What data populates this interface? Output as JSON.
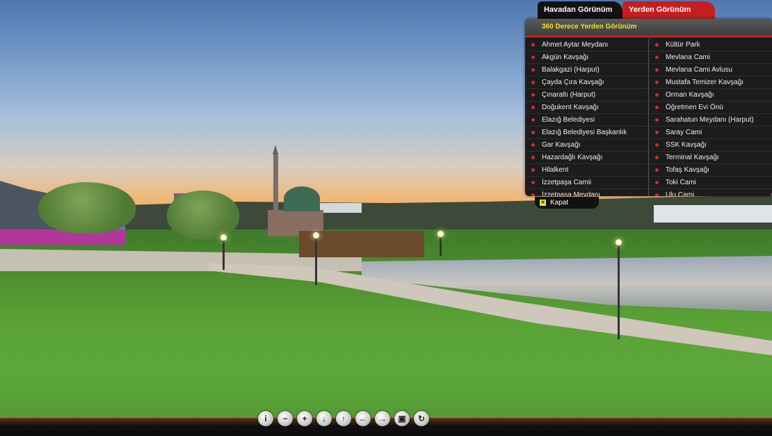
{
  "tabs": {
    "aerial": "Havadan Görünüm",
    "ground": "Yerden Görünüm"
  },
  "panel": {
    "title": "360 Derece Yerden Görünüm",
    "left_items": [
      "Ahmet Aytar Meydanı",
      "Akgün Kavşağı",
      "Balakgazi (Harput)",
      "Çayda Çıra Kavşağı",
      "Çınaraltı (Harput)",
      "Doğukent Kavşağı",
      "Elazığ Belediyesi",
      "Elazığ Belediyesi Başkanlık",
      "Gar Kavşağı",
      "Hazardağlı Kavşağı",
      "Hilalkent",
      "İzzetpaşa Camii",
      "İzzetpaşa Meydanı"
    ],
    "right_items": [
      "Kültür Park",
      "Mevlana Cami",
      "Mevlana Cami Avlusu",
      "Mustafa Temizer Kavşağı",
      "Orman Kavşağı",
      "Öğretmen Evi Önü",
      "Sarahatun  Meydanı (Harput)",
      "Saray Cami",
      "SSK Kavşağı",
      "Terminal Kavşağı",
      "Tofaş Kavşağı",
      "Toki Cami",
      "Ulu Cami"
    ],
    "close_label": "Kapat"
  },
  "controls": [
    {
      "icon": "info-icon",
      "glyph": "i"
    },
    {
      "icon": "zoom-out-icon",
      "glyph": "−"
    },
    {
      "icon": "zoom-in-icon",
      "glyph": "+"
    },
    {
      "icon": "arrow-down-icon",
      "glyph": "↓"
    },
    {
      "icon": "arrow-up-icon",
      "glyph": "↑"
    },
    {
      "icon": "arrow-left-icon",
      "glyph": "←"
    },
    {
      "icon": "arrow-right-icon",
      "glyph": "→"
    },
    {
      "icon": "fullscreen-icon",
      "glyph": "▣"
    },
    {
      "icon": "autorotate-icon",
      "glyph": "↻"
    }
  ],
  "colors": {
    "accent_red": "#c41e1e",
    "title_yellow": "#f2e21a"
  }
}
